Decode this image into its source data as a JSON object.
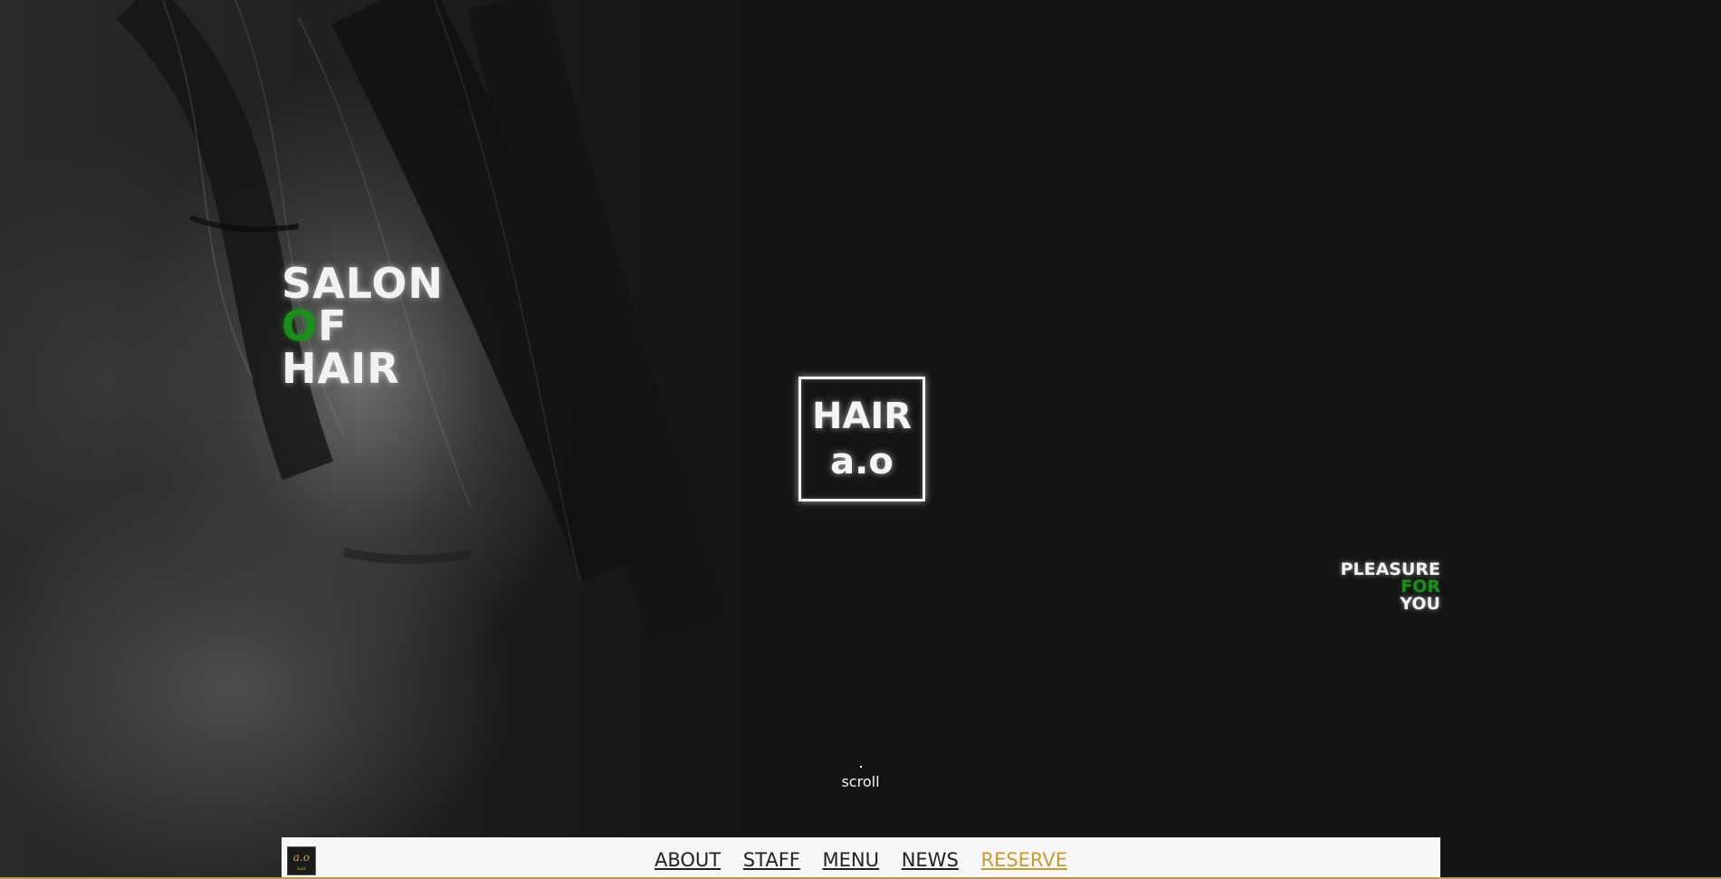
{
  "hero": {
    "title_line1": "SALON",
    "title_line2_accent": "O",
    "title_line2_rest": "F",
    "title_line3": "HAIR",
    "logo_line1": "HAIR",
    "logo_line2": "a.o",
    "tagline_line1": "PLEASURE",
    "tagline_line2": "FOR",
    "tagline_line3": "YOU",
    "scroll_label": "scroll"
  },
  "nav": {
    "logo_mark": "a.o",
    "logo_sub": "hair",
    "items": [
      {
        "label": "ABOUT"
      },
      {
        "label": "STAFF"
      },
      {
        "label": "MENU"
      },
      {
        "label": "NEWS"
      },
      {
        "label": "RESERVE"
      }
    ]
  },
  "colors": {
    "accent_green": "#1a8f1a",
    "reserve_gold": "#c99a2e",
    "background": "#141414",
    "nav_background": "#f7f7f7"
  }
}
